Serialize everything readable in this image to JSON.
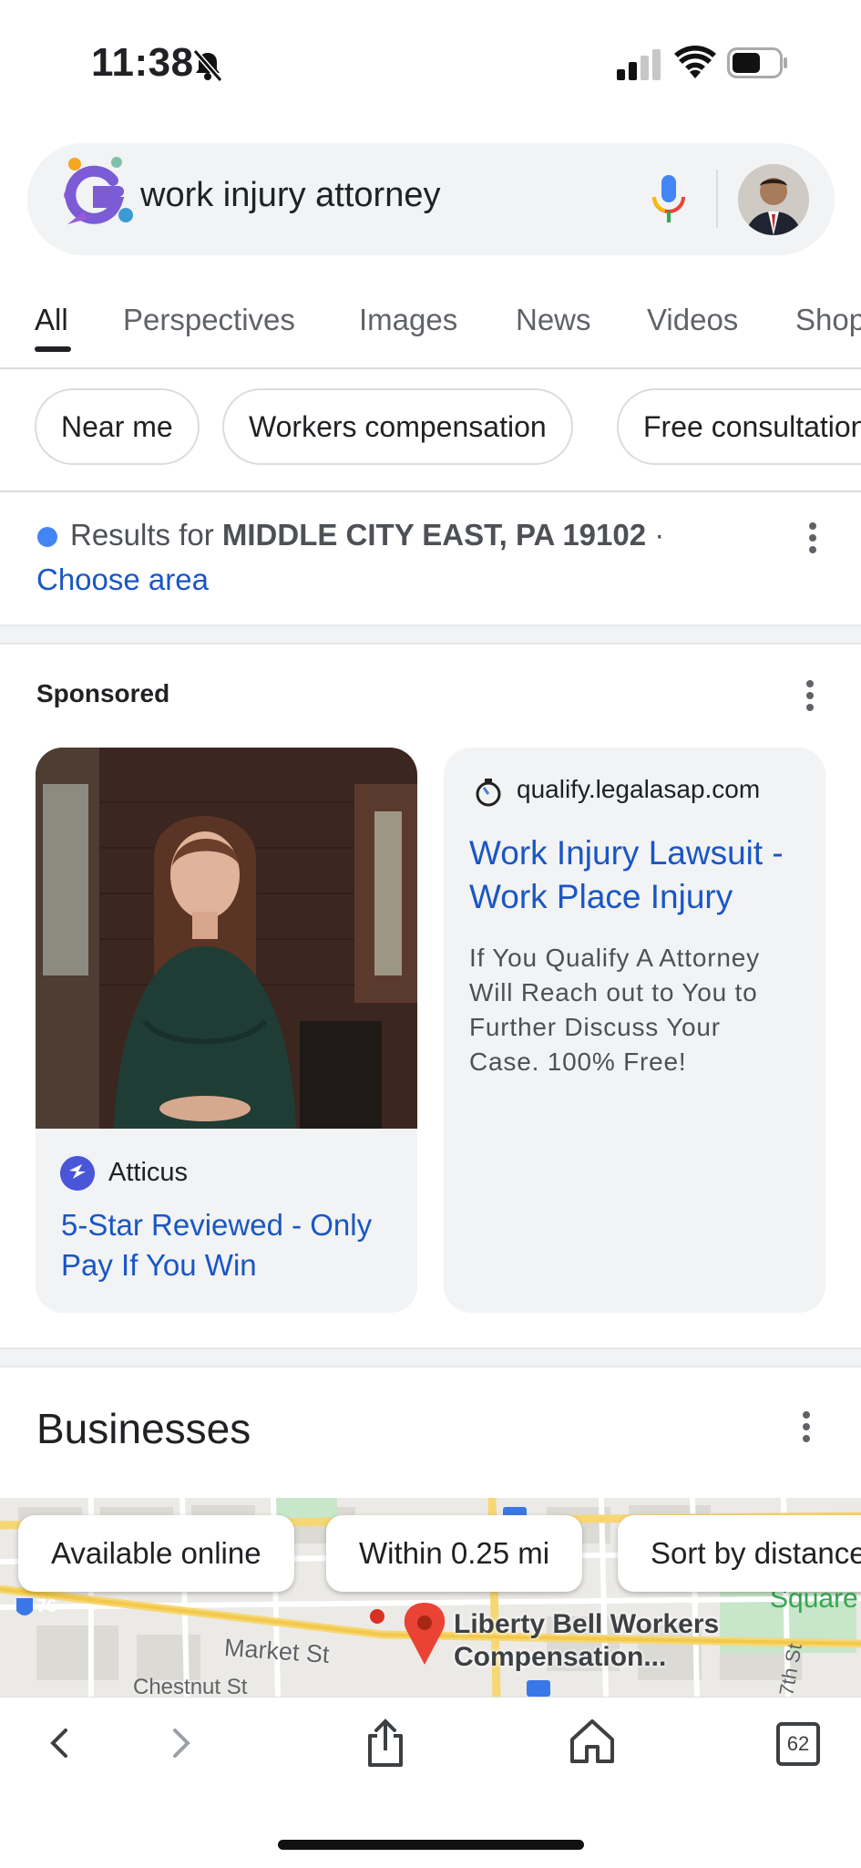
{
  "status_bar": {
    "time": "11:38"
  },
  "search": {
    "query": "work injury attorney"
  },
  "tabs": [
    {
      "label": "All",
      "active": true
    },
    {
      "label": "Perspectives"
    },
    {
      "label": "Images"
    },
    {
      "label": "News"
    },
    {
      "label": "Videos"
    },
    {
      "label": "Shop"
    }
  ],
  "chips": [
    "Near me",
    "Workers compensation",
    "Free consultation"
  ],
  "location": {
    "prefix": "Results for",
    "place": "MIDDLE CITY EAST, PA 19102",
    "bullet": "·",
    "choose_label": "Choose area"
  },
  "sponsored": {
    "label": "Sponsored",
    "ads": [
      {
        "advertiser": "Atticus",
        "headline": "5-Star Reviewed - Only Pay If You Win"
      },
      {
        "advertiser": "qualify.legalasap.com",
        "headline": "Work Injury Lawsuit - Work Place Injury",
        "description": "If You Qualify A Attorney Will Reach out to You to Further Discuss Your Case. 100% Free!"
      }
    ]
  },
  "businesses": {
    "title": "Businesses",
    "filters": [
      "Available online",
      "Within 0.25 mi",
      "Sort by distance"
    ],
    "map": {
      "pin_label_line1": "Liberty Bell Workers",
      "pin_label_line2": "Compensation...",
      "street": "Market St",
      "street2": "Chestnut St",
      "street3": "7th St",
      "area": "Square",
      "highway": "76"
    }
  },
  "toolbar": {
    "tabs_count": "62"
  },
  "colors": {
    "link": "#1a56c4",
    "chip_border": "#dadce0",
    "search_bg": "#f1f3f4",
    "pin": "#ea4335"
  }
}
